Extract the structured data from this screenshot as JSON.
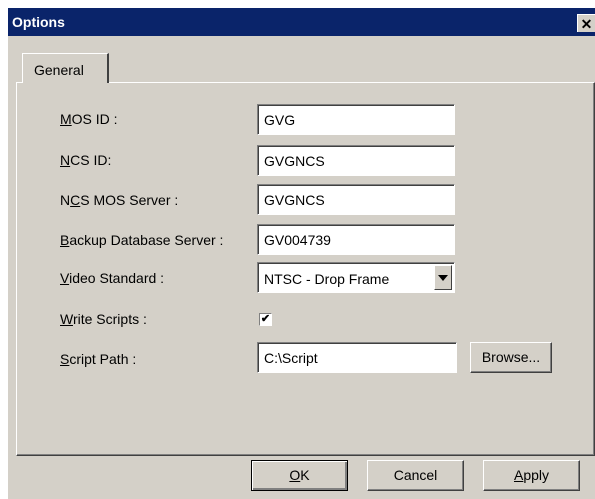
{
  "window": {
    "title": "Options",
    "close_glyph": "✕"
  },
  "tabs": [
    {
      "label": "General",
      "active": true
    }
  ],
  "form": {
    "mos_id": {
      "label_u": "M",
      "label_rest": "OS ID :",
      "value": "GVG"
    },
    "ncs_id": {
      "label_u": "N",
      "label_rest": "CS ID:",
      "value": "GVGNCS"
    },
    "ncs_mos_server": {
      "label_pre": "N",
      "label_u": "C",
      "label_rest": "S MOS Server :",
      "value": "GVGNCS"
    },
    "backup_db_server": {
      "label_u": "B",
      "label_rest": "ackup Database Server :",
      "value": "GV004739"
    },
    "video_standard": {
      "label_u": "V",
      "label_rest": "ideo Standard :",
      "value": "NTSC - Drop Frame"
    },
    "write_scripts": {
      "label_u": "W",
      "label_rest": "rite Scripts :",
      "checked": true,
      "check_glyph": "✔"
    },
    "script_path": {
      "label_u": "S",
      "label_rest": "cript Path :",
      "value": "C:\\Script"
    },
    "browse_label": "Browse..."
  },
  "buttons": {
    "ok_pre": "",
    "ok_u": "O",
    "ok_rest": "K",
    "cancel": "Cancel",
    "apply_u": "A",
    "apply_rest": "pply"
  }
}
